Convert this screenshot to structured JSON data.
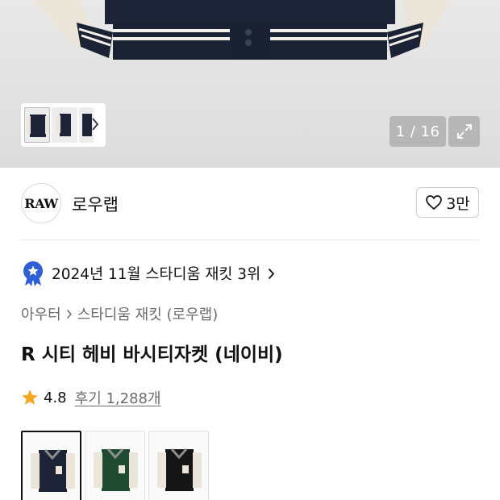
{
  "gallery": {
    "counter": "1 / 16",
    "thumbnails": [
      "navy-jacket-front",
      "navy-jacket-side",
      "navy-jacket-back"
    ]
  },
  "brand": {
    "logo_text": "RAW",
    "name": "로우랩",
    "like_count": "3만"
  },
  "ranking": {
    "text": "2024년 11월 스타디움 재킷 3위"
  },
  "breadcrumb": {
    "items": [
      "아우터",
      "스타디움 재킷 (로우랩)"
    ]
  },
  "product": {
    "title": "R 시티 헤비 바시티자켓 (네이비)",
    "rating": "4.8",
    "reviews": "후기 1,288개"
  },
  "colors": {
    "accent": "#2f5fd6",
    "star": "#f5a623",
    "options": [
      "navy",
      "green",
      "black"
    ],
    "selected": "navy"
  }
}
